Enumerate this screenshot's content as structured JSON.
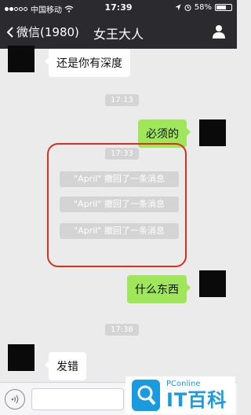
{
  "status_bar": {
    "carrier": "中国移动",
    "time": "17:39",
    "battery": "58%"
  },
  "nav": {
    "back_label": "微信(1980)",
    "title": "女王大人"
  },
  "messages": {
    "m1": "还是你有深度",
    "ts1": "17:13",
    "m2": "必须的",
    "ts2": "17:33",
    "recall1": "\"April\" 撤回了一条消息",
    "recall2": "\"April\" 撤回了一条消息",
    "recall3": "\"April\" 撤回了一条消息",
    "m3": "什么东西",
    "ts3": "17:38",
    "m4": "发错"
  },
  "watermark": {
    "small": "PConline",
    "big": "IT百科"
  },
  "colors": {
    "nav_bg": "#2b2b2f",
    "outgoing_bubble": "#9fe65a",
    "highlight_box": "#d8301f",
    "watermark": "#1a9be0"
  }
}
